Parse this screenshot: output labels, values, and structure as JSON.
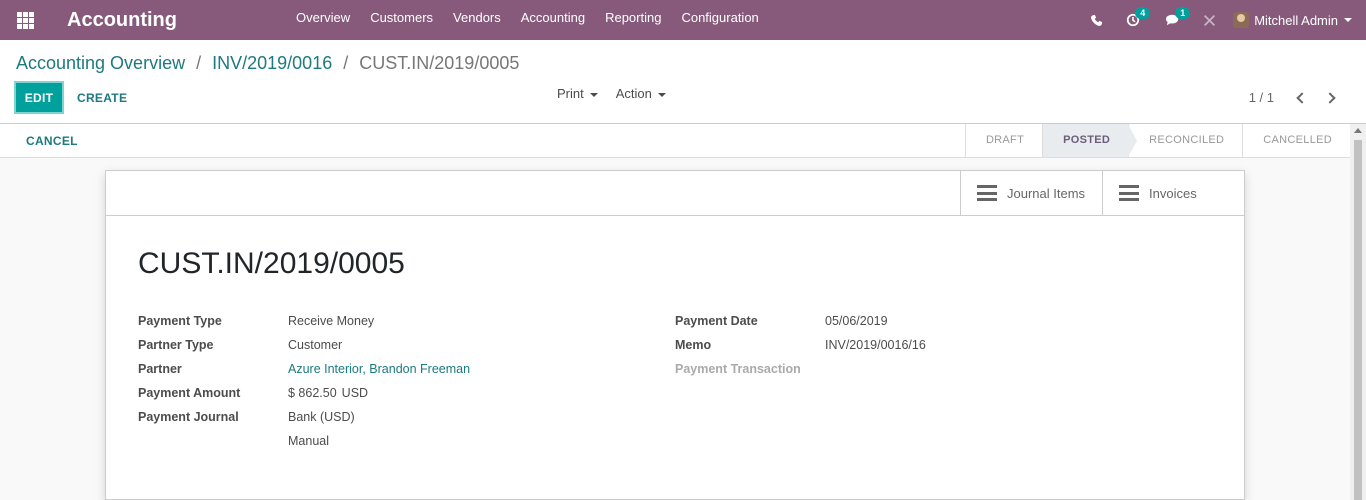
{
  "navbar": {
    "brand": "Accounting",
    "menu": [
      "Overview",
      "Customers",
      "Vendors",
      "Accounting",
      "Reporting",
      "Configuration"
    ],
    "activity_count": "4",
    "message_count": "1",
    "user": "Mitchell Admin"
  },
  "breadcrumb": {
    "root": "Accounting Overview",
    "parent": "INV/2019/0016",
    "current": "CUST.IN/2019/0005",
    "separator": "/"
  },
  "buttons": {
    "edit": "EDIT",
    "create": "CREATE",
    "print": "Print",
    "action": "Action",
    "cancel": "CANCEL"
  },
  "pager": {
    "value": "1 / 1"
  },
  "status": [
    "DRAFT",
    "POSTED",
    "RECONCILED",
    "CANCELLED"
  ],
  "smart_buttons": {
    "journal_items": "Journal Items",
    "invoices": "Invoices"
  },
  "record": {
    "title": "CUST.IN/2019/0005",
    "left": {
      "payment_type_label": "Payment Type",
      "payment_type": "Receive Money",
      "partner_type_label": "Partner Type",
      "partner_type": "Customer",
      "partner_label": "Partner",
      "partner": "Azure Interior, Brandon Freeman",
      "amount_label": "Payment Amount",
      "amount": "$ 862.50",
      "currency": "USD",
      "journal_label": "Payment Journal",
      "journal": "Bank (USD)",
      "method": "Manual"
    },
    "right": {
      "date_label": "Payment Date",
      "date": "05/06/2019",
      "memo_label": "Memo",
      "memo": "INV/2019/0016/16",
      "transaction_label": "Payment Transaction"
    }
  },
  "colors": {
    "navbar": "#875a7b",
    "primary": "#00a09d",
    "link": "#1c7a80"
  }
}
